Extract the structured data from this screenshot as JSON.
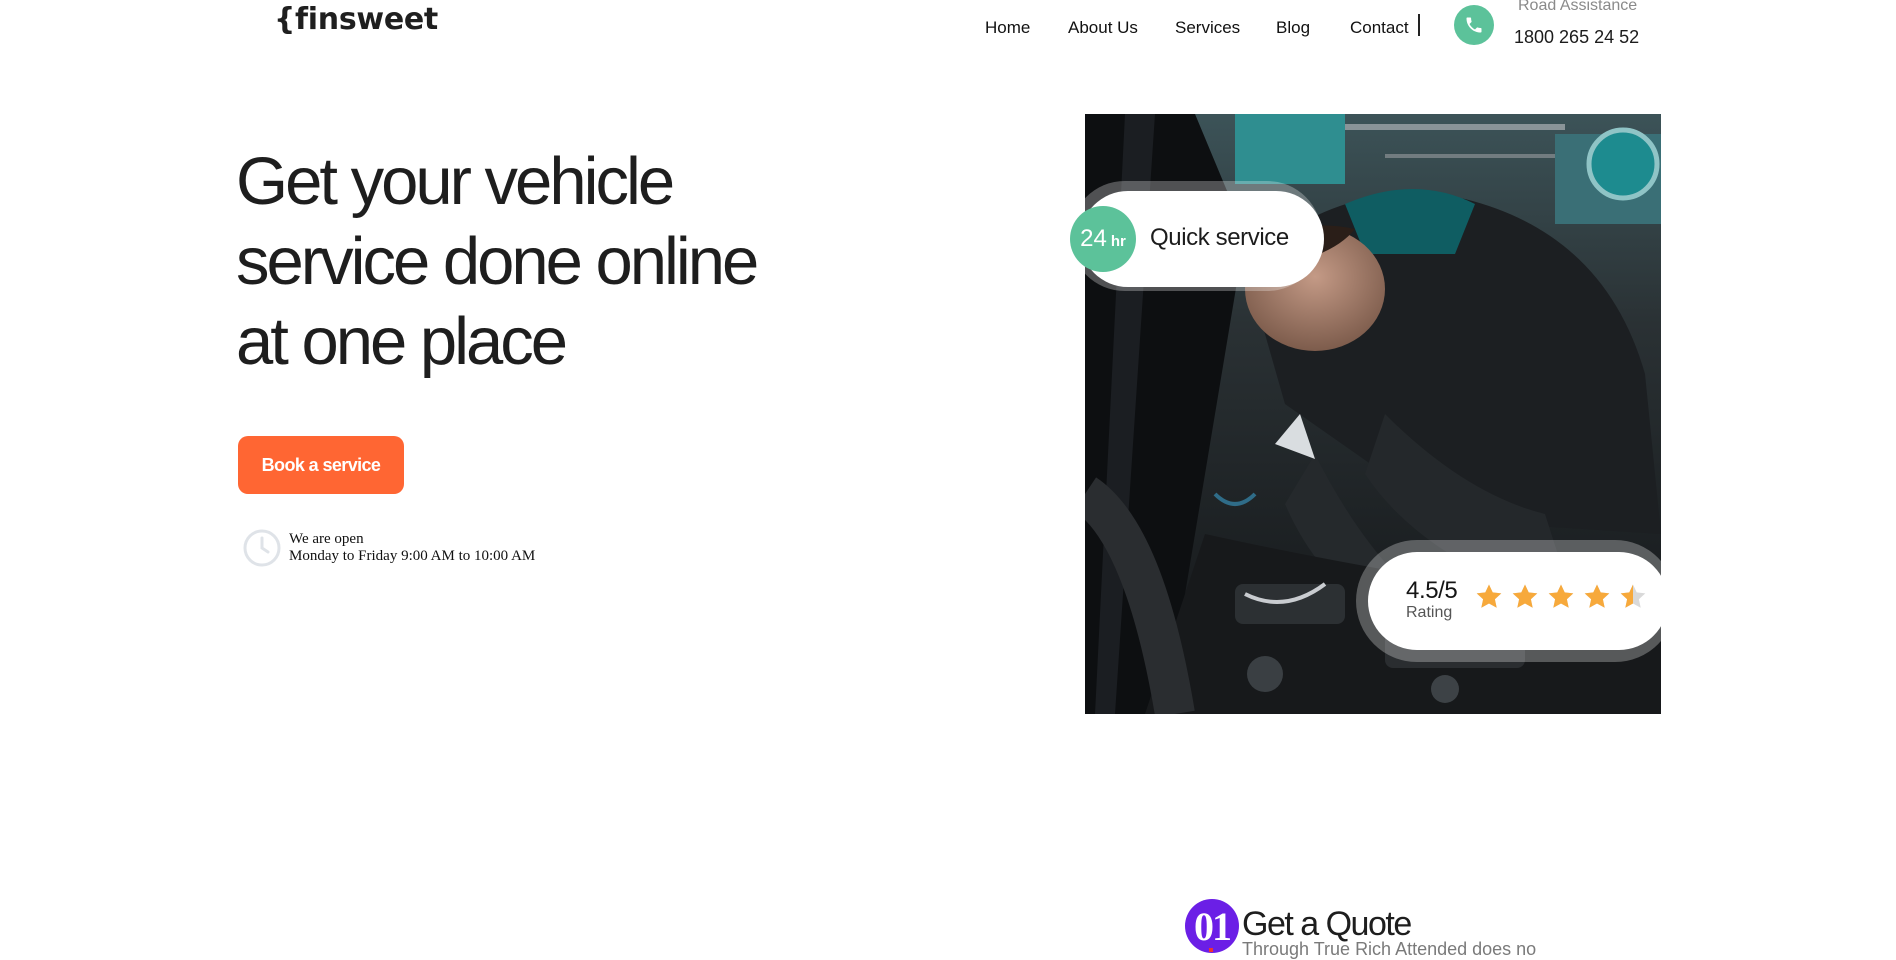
{
  "brand": {
    "logo_text": "{finsweet"
  },
  "nav": {
    "items": [
      "Home",
      "About Us",
      "Services",
      "Blog",
      "Contact"
    ]
  },
  "contact": {
    "label": "Road Assistance",
    "phone": "1800 265 24 52"
  },
  "hero": {
    "title_lines": [
      "Get your vehicle",
      "service done online",
      "at one place"
    ],
    "cta_label": "Book a service",
    "hours_title": "We are open",
    "hours_detail": "Monday to Friday 9:00 AM to 10:00 AM"
  },
  "badges": {
    "quick_number": "24",
    "quick_unit": "hr",
    "quick_text": "Quick service",
    "rating_value": "4.5/5",
    "rating_label": "Rating",
    "rating_stars": 4.5,
    "rating_max": 5
  },
  "steps": [
    {
      "number": "01",
      "title": "Get a Quote",
      "description": "Through True Rich Attended does no"
    }
  ],
  "colors": {
    "accent_orange": "#ff6633",
    "accent_green": "#5cc29a",
    "accent_purple": "#6b1fe6",
    "star": "#f7a93b"
  },
  "icons": {
    "phone": "phone-icon",
    "clock": "clock-icon",
    "star": "star-icon"
  }
}
